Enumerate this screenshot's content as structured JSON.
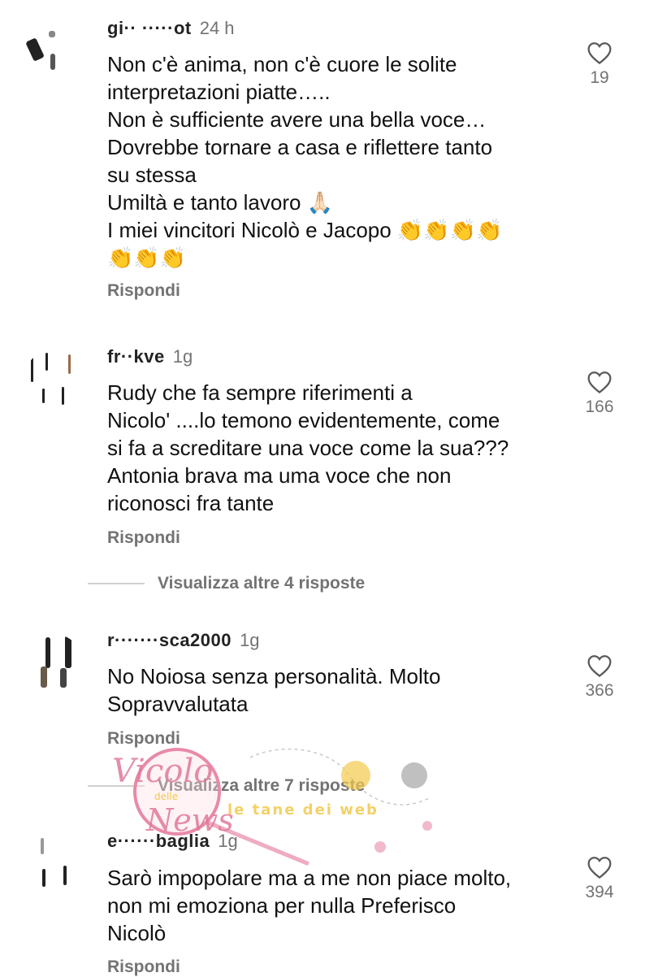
{
  "comments": [
    {
      "username": "gi·· ·····ot",
      "time": "24 h",
      "text": "Non c'è anima, non c'è cuore le solite\ninterpretazioni piatte…..\nNon è sufficiente avere una bella voce…\nDovrebbe tornare a casa e riflettere tanto\nsu stessa\nUmiltà e tanto lavoro 🙏🏻\nI miei vincitori Nicolò e Jacopo 👏👏👏👏\n👏👏👏",
      "likes": "19",
      "reply_label": "Rispondi"
    },
    {
      "username": "fr··kve",
      "time": "1g",
      "text": "Rudy che fa sempre riferimenti a\nNicolo' ....lo temono evidentemente, come\nsi fa a screditare una voce come la sua???\nAntonia brava ma uma voce che non\nriconosci fra tante",
      "likes": "166",
      "reply_label": "Rispondi",
      "view_more": "Visualizza altre 4 risposte"
    },
    {
      "username": "r·······sca2000",
      "time": "1g",
      "text": "No Noiosa senza personalità. Molto\nSopravvalutata",
      "likes": "366",
      "reply_label": "Rispondi",
      "view_more": "Visualizza altre 7 risposte"
    },
    {
      "username": "e······baglia",
      "time": "1g",
      "text": "Sarò impopolare ma a me non piace molto,\nnon mi emoziona per nulla Preferisco\nNicolò",
      "likes": "394",
      "reply_label": "Rispondi"
    }
  ],
  "watermark": {
    "brand_line1": "Vicolo",
    "brand_small": "delle",
    "brand_line2": "News",
    "tagline": "le tane dei web"
  },
  "colors": {
    "text": "#111111",
    "secondary": "#737373",
    "watermark_pink": "#e88aa8",
    "watermark_yellow": "#f2c94c"
  }
}
